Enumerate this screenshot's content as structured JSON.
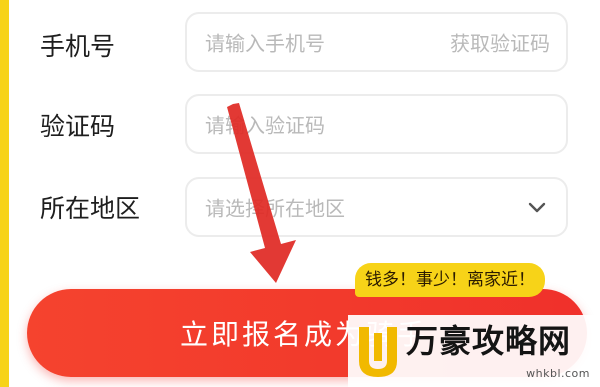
{
  "colors": {
    "accent_yellow": "#f7d318",
    "button_red": "#f23a2c",
    "arrow_red": "#e02a25",
    "watermark_gold": "#f1b900"
  },
  "form": {
    "phone": {
      "label": "手机号",
      "placeholder": "请输入手机号",
      "action_label": "获取验证码"
    },
    "code": {
      "label": "验证码",
      "placeholder": "请输入验证码"
    },
    "region": {
      "label": "所在地区",
      "placeholder": "请选择所在地区",
      "icon": "chevron-down-icon"
    }
  },
  "submit": {
    "label": "立即报名成为骑手"
  },
  "badge": {
    "text": "钱多！事少！离家近！"
  },
  "overlay": {
    "icon": "arrow-down-icon"
  },
  "watermark": {
    "icon": "wanhao-logo-icon",
    "text": "万豪攻略网",
    "url": "whkbl.com"
  }
}
